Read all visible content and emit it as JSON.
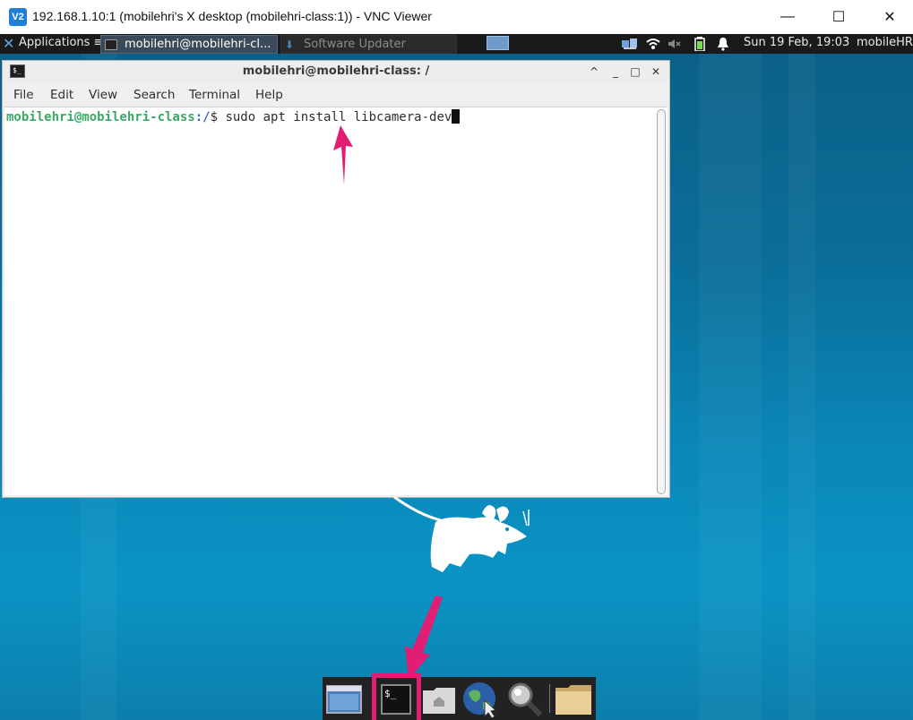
{
  "vnc_window": {
    "title": "192.168.1.10:1 (mobilehri's X desktop (mobilehri-class:1)) - VNC Viewer",
    "logo_text": "V2",
    "minimize_glyph": "—",
    "maximize_glyph": "☐",
    "close_glyph": "✕"
  },
  "top_panel": {
    "applications_label": "Applications ≡",
    "tasks": [
      {
        "label": "mobilehri@mobilehri-cl...",
        "icon": "terminal-icon",
        "active": true
      },
      {
        "label": "Software Updater",
        "icon": "download-icon",
        "active": false
      }
    ],
    "clock": "Sun 19 Feb, 19:03",
    "user": "mobileHR",
    "tray_icons": [
      "network-applet-icon",
      "wifi-icon",
      "volume-muted-icon",
      "battery-icon",
      "notification-bell-icon"
    ]
  },
  "terminal": {
    "title": "mobilehri@mobilehri-class: /",
    "menu": [
      "File",
      "Edit",
      "View",
      "Search",
      "Terminal",
      "Help"
    ],
    "prompt_user": "mobilehri@mobilehri-class",
    "prompt_path": ":/",
    "prompt_symbol": "$ ",
    "command": "sudo apt install libcamera-dev",
    "controls": {
      "shade": "^",
      "minimize": "_",
      "maximize": "□",
      "close": "✕"
    }
  },
  "dock": {
    "items": [
      "show-desktop-icon",
      "terminal-icon",
      "home-folder-icon",
      "web-browser-icon",
      "app-finder-icon",
      "file-manager-icon"
    ],
    "terminal_glyph": "$_"
  },
  "colors": {
    "accent_arrow": "#e11d74",
    "prompt_user": "#3aa866",
    "prompt_path": "#3d6bc4",
    "desktop": "#0a87b8"
  }
}
